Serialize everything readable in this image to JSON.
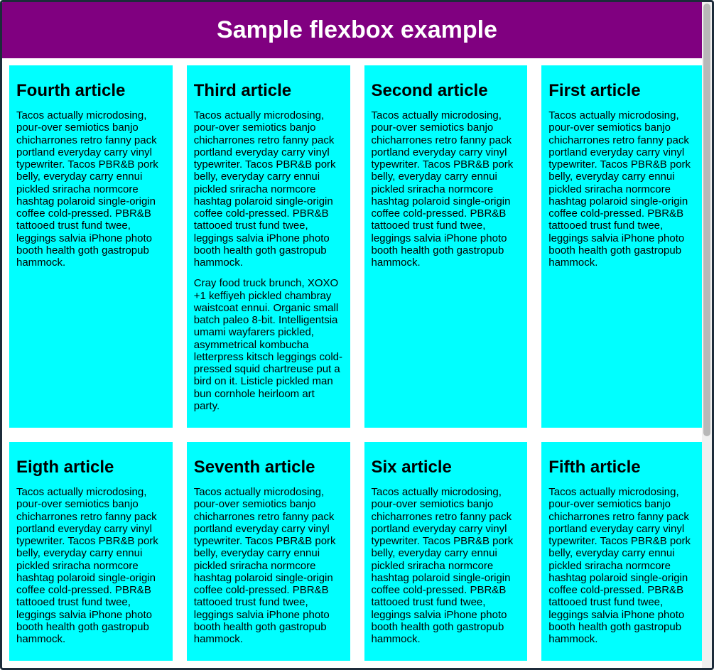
{
  "header": {
    "title": "Sample flexbox example"
  },
  "common_paragraph": "Tacos actually microdosing, pour-over semiotics banjo chicharrones retro fanny pack portland everyday carry vinyl typewriter. Tacos PBR&B pork belly, everyday carry ennui pickled sriracha normcore hashtag polaroid single-origin coffee cold-pressed. PBR&B tattooed trust fund twee, leggings salvia iPhone photo booth health goth gastropub hammock.",
  "extra_paragraph": "Cray food truck brunch, XOXO +1 keffiyeh pickled chambray waistcoat ennui. Organic small batch paleo 8-bit. Intelligentsia umami wayfarers pickled, asymmetrical kombucha letterpress kitsch leggings cold-pressed squid chartreuse put a bird on it. Listicle pickled man bun cornhole heirloom art party.",
  "articles": [
    {
      "title": "First article"
    },
    {
      "title": "Second article"
    },
    {
      "title": "Third article"
    },
    {
      "title": "Fourth article"
    },
    {
      "title": "Fifth article"
    },
    {
      "title": "Six article"
    },
    {
      "title": "Seventh article"
    },
    {
      "title": "Eigth article"
    }
  ]
}
